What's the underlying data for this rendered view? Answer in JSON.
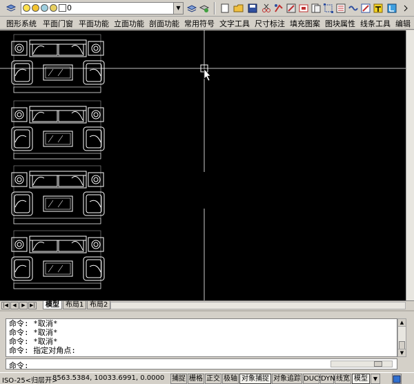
{
  "toolbar": {
    "layer_name": "0",
    "icons": [
      "layer-manager-icon",
      "layer-state-icon",
      "layer-previous-icon",
      "layer-iso-icon",
      "new-icon",
      "open-icon",
      "save-icon",
      "cut-icon",
      "copy-icon",
      "paste-icon",
      "match-icon",
      "undo-icon",
      "redo-icon",
      "pan-icon",
      "zoom-icon",
      "properties-icon",
      "design-center-icon",
      "tool-palette-icon"
    ]
  },
  "menu": {
    "items": [
      "图形系统",
      "平面门窗",
      "平面功能",
      "立面功能",
      "剖面功能",
      "常用符号",
      "文字工具",
      "尺寸标注",
      "填充图案",
      "图块属性",
      "线条工具",
      "编辑"
    ]
  },
  "layout_tabs": {
    "items": [
      "模型",
      "布局1",
      "布局2"
    ]
  },
  "command": {
    "history": [
      "命令: *取消*",
      "命令: *取消*",
      "命令: *取消*",
      "命令: 指定对角点:"
    ],
    "prompt": "命令:"
  },
  "status": {
    "left_label": "ISO-25<归层开>",
    "coordinates": "8563.5384,  10033.6991, 0.0000",
    "toggles": [
      {
        "label": "捕捉",
        "on": false
      },
      {
        "label": "栅格",
        "on": false
      },
      {
        "label": "正交",
        "on": false
      },
      {
        "label": "极轴",
        "on": false
      },
      {
        "label": "对象捕捉",
        "on": true
      },
      {
        "label": "对象追踪",
        "on": false
      },
      {
        "label": "DUCS",
        "on": false
      },
      {
        "label": "DYN",
        "on": false
      },
      {
        "label": "线宽",
        "on": false
      },
      {
        "label": "模型",
        "on": true
      }
    ]
  },
  "colors": {
    "canvas": "#000000",
    "linework": "#ffffff",
    "chrome": "#d4d0c8"
  }
}
